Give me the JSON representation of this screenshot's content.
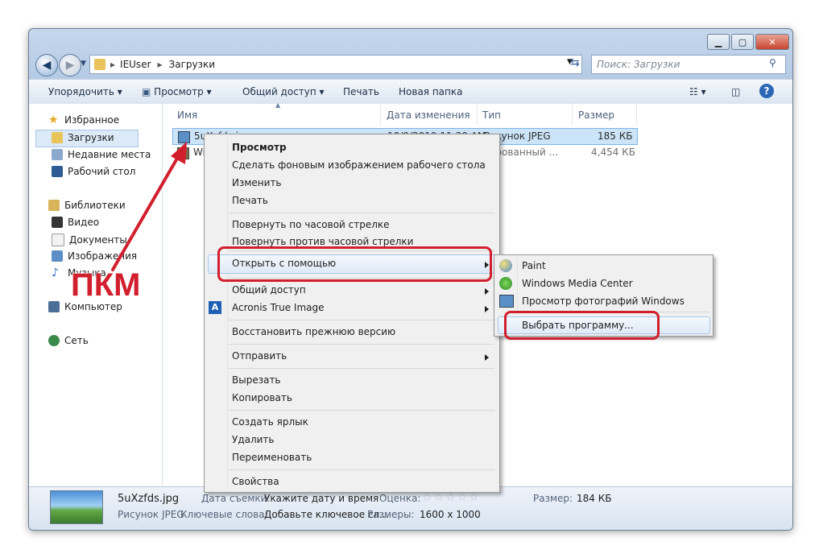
{
  "window": {
    "address_path": [
      "IEUser",
      "Загрузки"
    ],
    "search_placeholder": "Поиск: Загрузки"
  },
  "toolbar": {
    "organize": "Упорядочить",
    "view": "Просмотр",
    "share": "Общий доступ",
    "print": "Печать",
    "new_folder": "Новая папка"
  },
  "sidebar": {
    "favorites": "Избранное",
    "downloads": "Загрузки",
    "recent": "Недавние места",
    "desktop": "Рабочий стол",
    "libraries": "Библиотеки",
    "video": "Видео",
    "documents": "Документы",
    "images": "Изображения",
    "music": "Музыка",
    "computer": "Компьютер",
    "network": "Сеть"
  },
  "columns": {
    "name": "Имя",
    "date": "Дата изменения",
    "type": "Тип",
    "size": "Размер"
  },
  "files": [
    {
      "name": "5uXzfds.jpg",
      "date": "10/9/2019 11:30 AM",
      "type": "Рисунок JPEG",
      "size": "185 КБ"
    },
    {
      "name": "Windows",
      "date": "",
      "type": "лированный ...",
      "size": "4,454 КБ"
    }
  ],
  "context_menu": {
    "items": [
      "Просмотр",
      "Сделать фоновым изображением рабочего стола",
      "Изменить",
      "Печать",
      "Повернуть по часовой стрелке",
      "Повернуть против часовой стрелки",
      "Открыть с помощью",
      "Общий доступ",
      "Acronis True Image",
      "Восстановить прежнюю версию",
      "Отправить",
      "Вырезать",
      "Копировать",
      "Создать ярлык",
      "Удалить",
      "Переименовать",
      "Свойства"
    ]
  },
  "submenu": {
    "items": [
      "Paint",
      "Windows Media Center",
      "Просмотр фотографий Windows",
      "Выбрать программу..."
    ]
  },
  "details": {
    "filename": "5uXzfds.jpg",
    "filetype": "Рисунок JPEG",
    "date_label": "Дата съемки:",
    "date_value": "Укажите дату и время",
    "rating_label": "Оценка:",
    "keywords_label": "Ключевые слова:",
    "keywords_value": "Добавьте ключевое сл...",
    "dimensions_label": "Размеры:",
    "dimensions_value": "1600 x 1000",
    "size_label": "Размер:",
    "size_value": "184 КБ"
  },
  "annotation": {
    "label": "ПКМ",
    "color": "#d21f2d"
  }
}
